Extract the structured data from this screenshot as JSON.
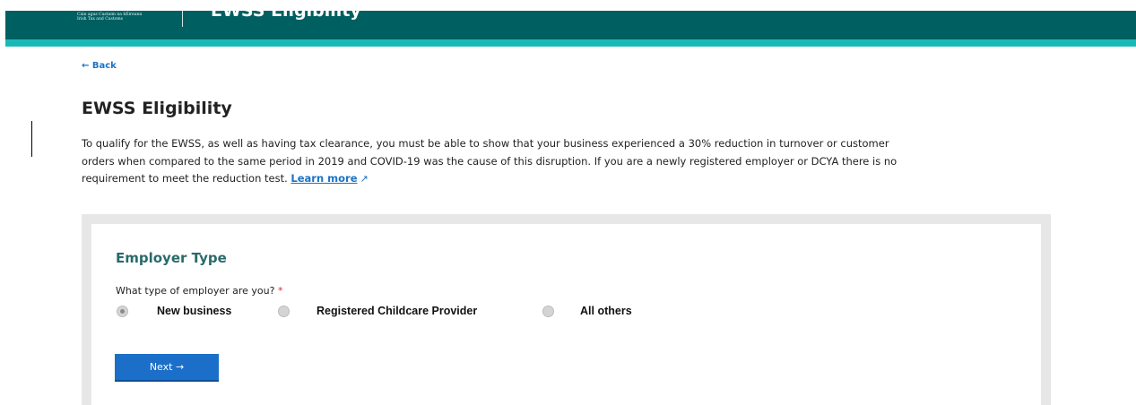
{
  "header": {
    "logo_line1": "Cáin agus Custaim na hÉireann",
    "logo_line2": "Irish Tax and Customs",
    "app_title": "EWSS Eligibility"
  },
  "nav": {
    "back_label": "← Back"
  },
  "page": {
    "title": "EWSS Eligibility",
    "intro_text": "To qualify for the EWSS, as well as having tax clearance, you must be able to show that your business experienced a 30% reduction in turnover or customer orders when compared to the same period in 2019 and COVID-19 was the cause of this disruption. If you are a newly registered employer or DCYA there is no requirement to meet the reduction test.",
    "learn_more_label": "Learn more",
    "external_icon": "↗"
  },
  "form": {
    "section_title": "Employer Type",
    "question": "What type of employer are you?",
    "required_marker": "*",
    "options": [
      {
        "label": "New business",
        "selected": true
      },
      {
        "label": "Registered  Childcare Provider",
        "selected": false
      },
      {
        "label": "All others",
        "selected": false
      }
    ],
    "next_label": "Next  →"
  },
  "colors": {
    "header_bg": "#005f61",
    "header_accent": "#1ab9b7",
    "link": "#1b73c6",
    "button": "#1b6fc8",
    "section_title": "#2a6a6a"
  }
}
